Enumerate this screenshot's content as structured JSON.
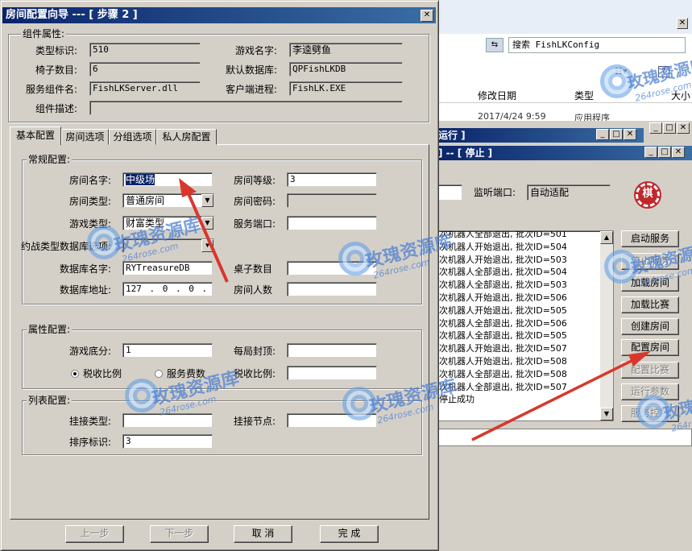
{
  "bg_explorer": {
    "search_label": "搜索 FishLKConfig",
    "col_date": "修改日期",
    "col_type": "类型",
    "col_size": "大小",
    "row_date": "2017/4/24 9:59",
    "row_type": "应用程序"
  },
  "bg_server": {
    "title_frag": "运行 ]",
    "title2_frag": "] -- [ 停止 ]",
    "port_label": "监听端口:",
    "port_value": "自动适配",
    "log_lines": [
      "次机器人全部退出, 批次ID=501",
      "次机器人开始退出, 批次ID=504",
      "次机器人开始退出, 批次ID=503",
      "次机器人全部退出, 批次ID=504",
      "次机器人全部退出, 批次ID=503",
      "次机器人开始退出, 批次ID=506",
      "次机器人开始退出, 批次ID=505",
      "次机器人全部退出, 批次ID=506",
      "次机器人全部退出, 批次ID=505",
      "次机器人开始退出, 批次ID=507",
      "次机器人开始退出, 批次ID=508",
      "次机器人全部退出, 批次ID=508",
      "次机器人全部退出, 批次ID=507",
      "停止成功"
    ],
    "buttons": [
      "启动服务",
      "停止服务",
      "加载房间",
      "加载比赛",
      "创建房间",
      "配置房间",
      "配置比赛",
      "运行参数",
      "服务控制"
    ]
  },
  "dialog": {
    "title": "房间配置向导 --- [ 步骤 2 ]",
    "component_group": "组件属性:",
    "type_id_label": "类型标识:",
    "type_id": "510",
    "game_name_label": "游戏名字:",
    "game_name": "李逵劈鱼",
    "chair_count_label": "椅子数目:",
    "chair_count": "6",
    "default_db_label": "默认数据库:",
    "default_db": "QPFishLKDB",
    "service_comp_label": "服务组件名:",
    "service_comp": "FishLKServer.dll",
    "client_proc_label": "客户端进程:",
    "client_proc": "FishLK.EXE",
    "comp_desc_label": "组件描述:",
    "comp_desc": "",
    "tabs": [
      "基本配置",
      "房间选项",
      "分组选项",
      "私人房配置"
    ],
    "general_group": "常规配置:",
    "room_name_label": "房间名字:",
    "room_name": "中级场",
    "room_level_label": "房间等级:",
    "room_level": "3",
    "room_type_label": "房间类型:",
    "room_type": "普通房间",
    "room_pwd_label": "房间密码:",
    "game_type_label": "游戏类型:",
    "game_type": "财富类型",
    "service_port_label": "服务端口:",
    "battle_type_label": "约战类型数据库选项:",
    "db_name_label": "数据库名字:",
    "db_name": "RYTreasureDB",
    "table_count_label": "桌子数目",
    "db_addr_label": "数据库地址:",
    "db_addr": "127 . 0 . 0 . 1",
    "room_people_label": "房间人数",
    "attr_group": "属性配置:",
    "game_base_label": "游戏底分:",
    "game_base": "1",
    "day_cap_label": "每局封顶:",
    "tax_rate_option": "税收比例",
    "service_fee_option": "服务费数",
    "tax_ratio_label": "税收比例:",
    "list_group": "列表配置:",
    "mount_type_label": "挂接类型:",
    "mount_node_label": "挂接节点:",
    "sort_id_label": "排序标识:",
    "sort_id": "3",
    "btn_prev": "上一步",
    "btn_next": "下一步",
    "btn_cancel": "取 消",
    "btn_finish": "完 成"
  },
  "watermark": {
    "text": "玫瑰资源库",
    "site": "264rose.com"
  },
  "colors": {
    "title_bar": "#0a246a",
    "face": "#d4d0c8",
    "arrow": "#d9372c",
    "watermark": "#5082d2"
  }
}
